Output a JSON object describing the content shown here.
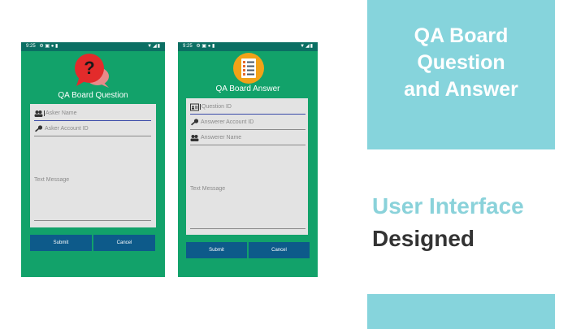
{
  "phone_question": {
    "status_time": "9:25",
    "title": "QA Board Question",
    "fields": [
      {
        "placeholder": "Asker Name"
      },
      {
        "placeholder": "Asker Account ID"
      }
    ],
    "message_label": "Text Message",
    "submit_label": "Submit",
    "cancel_label": "Cancel"
  },
  "phone_answer": {
    "status_time": "9:25",
    "title": "QA Board Answer",
    "fields": [
      {
        "placeholder": "Question ID"
      },
      {
        "placeholder": "Answerer Account ID"
      },
      {
        "placeholder": "Answerer Name"
      }
    ],
    "message_label": "Text Message",
    "submit_label": "Submit",
    "cancel_label": "Cancel"
  },
  "tile": {
    "title_lines": [
      "QA Board",
      "Question",
      "and Answer"
    ]
  },
  "caption": {
    "heading": "User Interface",
    "subheading": "Designed"
  },
  "colors": {
    "app_green": "#12a26a",
    "status_bar": "#0b6f63",
    "button_blue": "#0d5a8a",
    "tile_teal": "#86d4dc",
    "card_gray": "#e3e3e3"
  },
  "icons": [
    "question-bubble-icon",
    "checklist-icon",
    "person-icon",
    "key-icon",
    "id-card-icon"
  ]
}
